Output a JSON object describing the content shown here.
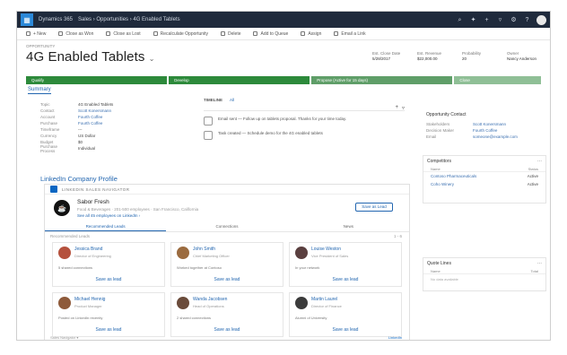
{
  "topnav": {
    "app_name": "Dynamics 365",
    "breadcrumb": "Sales  ›  Opportunities  ›  4G Enabled Tablets",
    "icons": [
      "search-icon",
      "lightbulb-icon",
      "plus-icon",
      "filter-icon",
      "settings-icon",
      "help-icon",
      "user-avatar"
    ]
  },
  "cmdbar": {
    "items": [
      "+ New",
      "Close as Won",
      "Close as Lost",
      "Recalculate Opportunity",
      "Delete",
      "Add to Queue",
      "Assign",
      "Email a Link"
    ]
  },
  "header": {
    "record_type": "OPPORTUNITY",
    "title": "4G Enabled Tablets",
    "fields": [
      {
        "label": "Est. Close Date",
        "value": "5/28/2017"
      },
      {
        "label": "Est. Revenue",
        "value": "$22,000.00"
      },
      {
        "label": "Probability",
        "value": "20"
      },
      {
        "label": "Owner",
        "value": "Nancy Anderson"
      }
    ]
  },
  "bpf": {
    "stages": [
      "Qualify",
      "Develop",
      "Propose (Active for 15 days)",
      "Close"
    ]
  },
  "summary": {
    "tab_label": "Summary",
    "fields": [
      {
        "label": "Topic",
        "value": "4G Enabled Tablets"
      },
      {
        "label": "Contact",
        "value": "Scott Konersmann"
      },
      {
        "label": "Account",
        "value": "Fourth Coffee"
      },
      {
        "label": "Purchase",
        "value": "Fourth Coffee"
      },
      {
        "label": "Timeframe",
        "value": "---"
      },
      {
        "label": "Currency",
        "value": "US Dollar"
      },
      {
        "label": "Budget",
        "value": "$0"
      },
      {
        "label": "Purchase Process",
        "value": "Individual"
      }
    ],
    "timeline": {
      "title": "TIMELINE",
      "filter_label": "All",
      "items": [
        {
          "text": "Email sent — Follow up on tablets proposal. Thanks for your time today."
        },
        {
          "text": "Task created — Schedule demo for the 4G enabled tablets"
        }
      ]
    }
  },
  "assistant": {
    "title": "Opportunity Contact",
    "rows": [
      {
        "label": "Stakeholders",
        "value": "Scott Konersmann"
      },
      {
        "label": "Decision Maker",
        "value": "Fourth Coffee"
      },
      {
        "label": "Email",
        "value": "someone@example.com"
      }
    ]
  },
  "competitors": {
    "title": "Competitors",
    "headers": [
      "Name",
      "Status"
    ],
    "rows": [
      {
        "name": "Contoso Pharmaceuticals",
        "status": "Active"
      },
      {
        "name": "Coho Winery",
        "status": "Active"
      }
    ]
  },
  "linkedin": {
    "title": "LinkedIn Company Profile",
    "header": "LINKEDIN SALES NAVIGATOR",
    "company": {
      "logo_glyph": "☕",
      "name": "Sabor Fresh",
      "subtitle": "Food & Beverages · 201-500 employees · San Francisco, California",
      "link": "See all 45 employees on LinkedIn ›"
    },
    "follow_label": "Save as Lead",
    "tabs": [
      "Recommended Leads",
      "Connections",
      "News"
    ],
    "sub_left": "Recommended Leads",
    "sub_right": "1 - 6",
    "cards": [
      {
        "name": "Jessica Brand",
        "title": "Director of Engineering",
        "note": "5 shared connections",
        "button": "Save as lead",
        "color": "#b5513d"
      },
      {
        "name": "John Smith",
        "title": "Chief Marketing Officer",
        "note": "Worked together at Contoso",
        "button": "Save as lead",
        "color": "#9b6b3f"
      },
      {
        "name": "Louise Weston",
        "title": "Vice President of Sales",
        "note": "In your network",
        "button": "Save as lead",
        "color": "#5a3f3f"
      },
      {
        "name": "Michael Hennig",
        "title": "Product Manager",
        "note": "Posted on LinkedIn recently",
        "button": "Save as lead",
        "color": "#8e5a3a"
      },
      {
        "name": "Wanda Jacobsen",
        "title": "Head of Operations",
        "note": "2 shared connections",
        "button": "Save as lead",
        "color": "#6a4b3a"
      },
      {
        "name": "Martin Laurel",
        "title": "Director of Finance",
        "note": "Alumni of University",
        "button": "Save as lead",
        "color": "#3b3b3b"
      }
    ],
    "footer_left": "Sales Navigator  ▾",
    "footer_right": "LinkedIn"
  },
  "right_bottom": {
    "title": "Quote Lines",
    "headers": [
      "Name",
      "Total"
    ],
    "empty": "No data available"
  }
}
